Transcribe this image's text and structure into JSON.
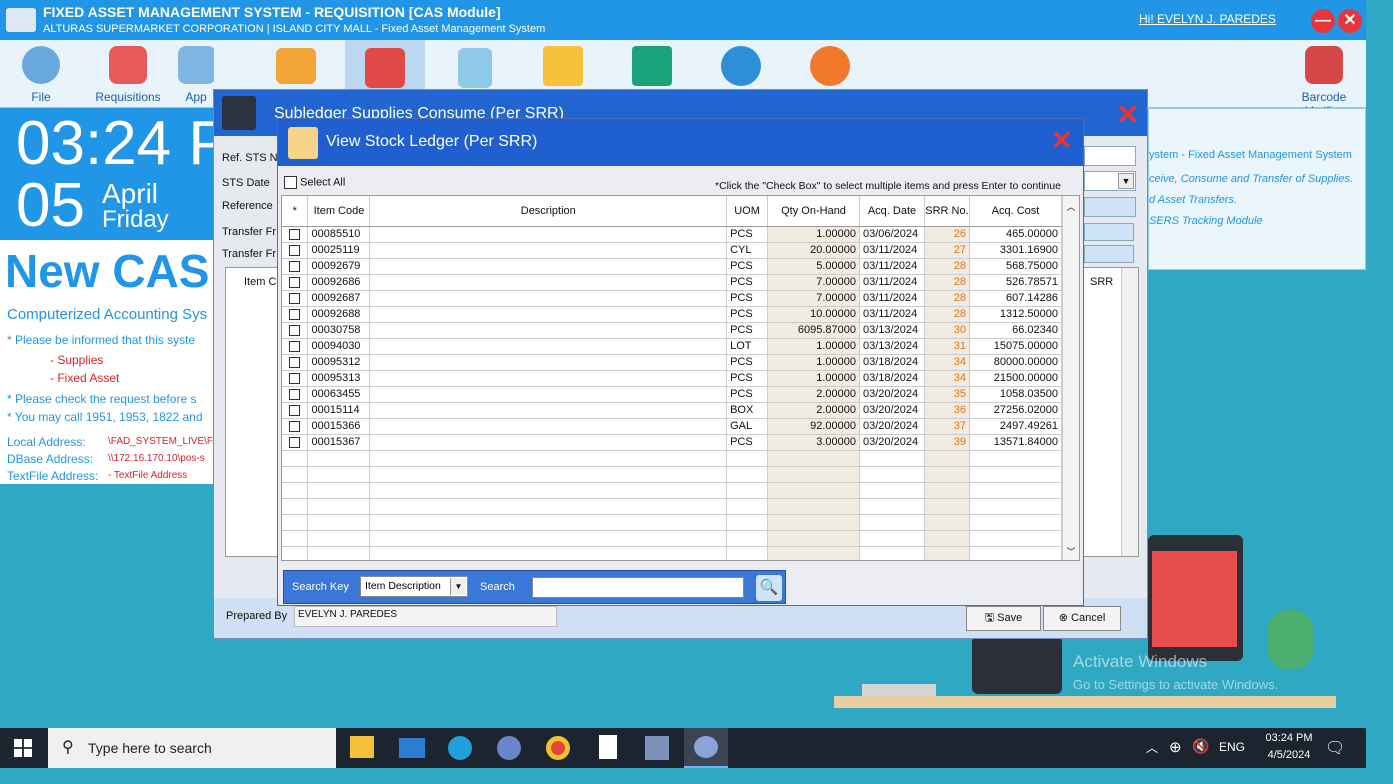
{
  "app": {
    "title": "FIXED ASSET MANAGEMENT SYSTEM - REQUISITION [CAS Module]",
    "subtitle": "ALTURAS SUPERMARKET CORPORATION | ISLAND CITY MALL - Fixed Asset Management System",
    "user": "Hi! EVELYN J. PAREDES",
    "minimize": "—",
    "close": "✕"
  },
  "toolbar": {
    "items": [
      {
        "label": "File"
      },
      {
        "label": "Requisitions"
      },
      {
        "label": "App"
      },
      {
        "label": "Barcode Verifier"
      }
    ]
  },
  "clock": {
    "time": "03:24 P",
    "day": "05",
    "month": "April",
    "weekday": "Friday"
  },
  "info": {
    "banner": "New CAS",
    "heading": "Computerized Accounting Sys",
    "line1": "* Please be informed that this syste",
    "item1": "- Supplies",
    "item2": "- Fixed Asset",
    "line2": "* Please check the request before s",
    "line3": "* You may call 1951, 1953, 1822 and",
    "local_label": "Local Address:",
    "local_value": "\\FAD_SYSTEM_LIVE\\FA",
    "dbase_label": "DBase Address:",
    "dbase_value": "\\\\172.16.170.10\\pos-s",
    "text_label": "TextFile Address:",
    "text_value": "- TextFile Address"
  },
  "right_panel": {
    "l1": "ystem - Fixed Asset Management System",
    "l2": "ceive, Consume and Transfer of Supplies.",
    "l3": "d Asset Transfers.",
    "l4": "SERS Tracking Module"
  },
  "subledger": {
    "title": "Subledger Supplies Consume (Per SRR)",
    "ref_label": "Ref. STS No",
    "date_label": "STS Date",
    "reference_label": "Reference",
    "tf1_label": "Transfer Fr",
    "tf2_label": "Transfer Fr",
    "col_item": "Item Co",
    "col_srr": "SRR",
    "prepared_label": "Prepared By",
    "prepared_value": "EVELYN J. PAREDES",
    "save": "Save",
    "cancel": "Cancel"
  },
  "ledger": {
    "title": "View Stock Ledger (Per SRR)",
    "select_all": "Select All",
    "hint": "*Click the \"Check Box\" to select multiple items and press Enter to continue",
    "columns": [
      "*",
      "Item Code",
      "Description",
      "UOM",
      "Qty On-Hand",
      "Acq. Date",
      "SRR No.",
      "Acq. Cost"
    ],
    "rows": [
      {
        "code": "00085510",
        "uom": "PCS",
        "qty": "1.00000",
        "date": "03/06/2024",
        "srr": "26",
        "cost": "465.00000"
      },
      {
        "code": "00025119",
        "uom": "CYL",
        "qty": "20.00000",
        "date": "03/11/2024",
        "srr": "27",
        "cost": "3301.16900"
      },
      {
        "code": "00092679",
        "uom": "PCS",
        "qty": "5.00000",
        "date": "03/11/2024",
        "srr": "28",
        "cost": "568.75000"
      },
      {
        "code": "00092686",
        "uom": "PCS",
        "qty": "7.00000",
        "date": "03/11/2024",
        "srr": "28",
        "cost": "526.78571"
      },
      {
        "code": "00092687",
        "uom": "PCS",
        "qty": "7.00000",
        "date": "03/11/2024",
        "srr": "28",
        "cost": "607.14286"
      },
      {
        "code": "00092688",
        "uom": "PCS",
        "qty": "10.00000",
        "date": "03/11/2024",
        "srr": "28",
        "cost": "1312.50000"
      },
      {
        "code": "00030758",
        "uom": "PCS",
        "qty": "6095.87000",
        "date": "03/13/2024",
        "srr": "30",
        "cost": "66.02340"
      },
      {
        "code": "00094030",
        "uom": "LOT",
        "qty": "1.00000",
        "date": "03/13/2024",
        "srr": "31",
        "cost": "15075.00000"
      },
      {
        "code": "00095312",
        "uom": "PCS",
        "qty": "1.00000",
        "date": "03/18/2024",
        "srr": "34",
        "cost": "80000.00000"
      },
      {
        "code": "00095313",
        "uom": "PCS",
        "qty": "1.00000",
        "date": "03/18/2024",
        "srr": "34",
        "cost": "21500.00000"
      },
      {
        "code": "00063455",
        "uom": "PCS",
        "qty": "2.00000",
        "date": "03/20/2024",
        "srr": "35",
        "cost": "1058.03500"
      },
      {
        "code": "00015114",
        "uom": "BOX",
        "qty": "2.00000",
        "date": "03/20/2024",
        "srr": "36",
        "cost": "27256.02000"
      },
      {
        "code": "00015366",
        "uom": "GAL",
        "qty": "92.00000",
        "date": "03/20/2024",
        "srr": "37",
        "cost": "2497.49261"
      },
      {
        "code": "00015367",
        "uom": "PCS",
        "qty": "3.00000",
        "date": "03/20/2024",
        "srr": "39",
        "cost": "13571.84000"
      }
    ],
    "search_key_label": "Search Key",
    "search_key_value": "Item Description",
    "search_label": "Search",
    "search_value": ""
  },
  "watermark": {
    "l1": "Activate Windows",
    "l2": "Go to Settings to activate Windows."
  },
  "taskbar": {
    "search_placeholder": "Type here to search",
    "lang": "ENG",
    "time": "03:24 PM",
    "date": "4/5/2024"
  },
  "colors": {
    "titlebar": "#2196e6",
    "dialog_head": "#1f5fcf",
    "srr_text": "#e07020",
    "desktop": "#2fa8c4"
  }
}
